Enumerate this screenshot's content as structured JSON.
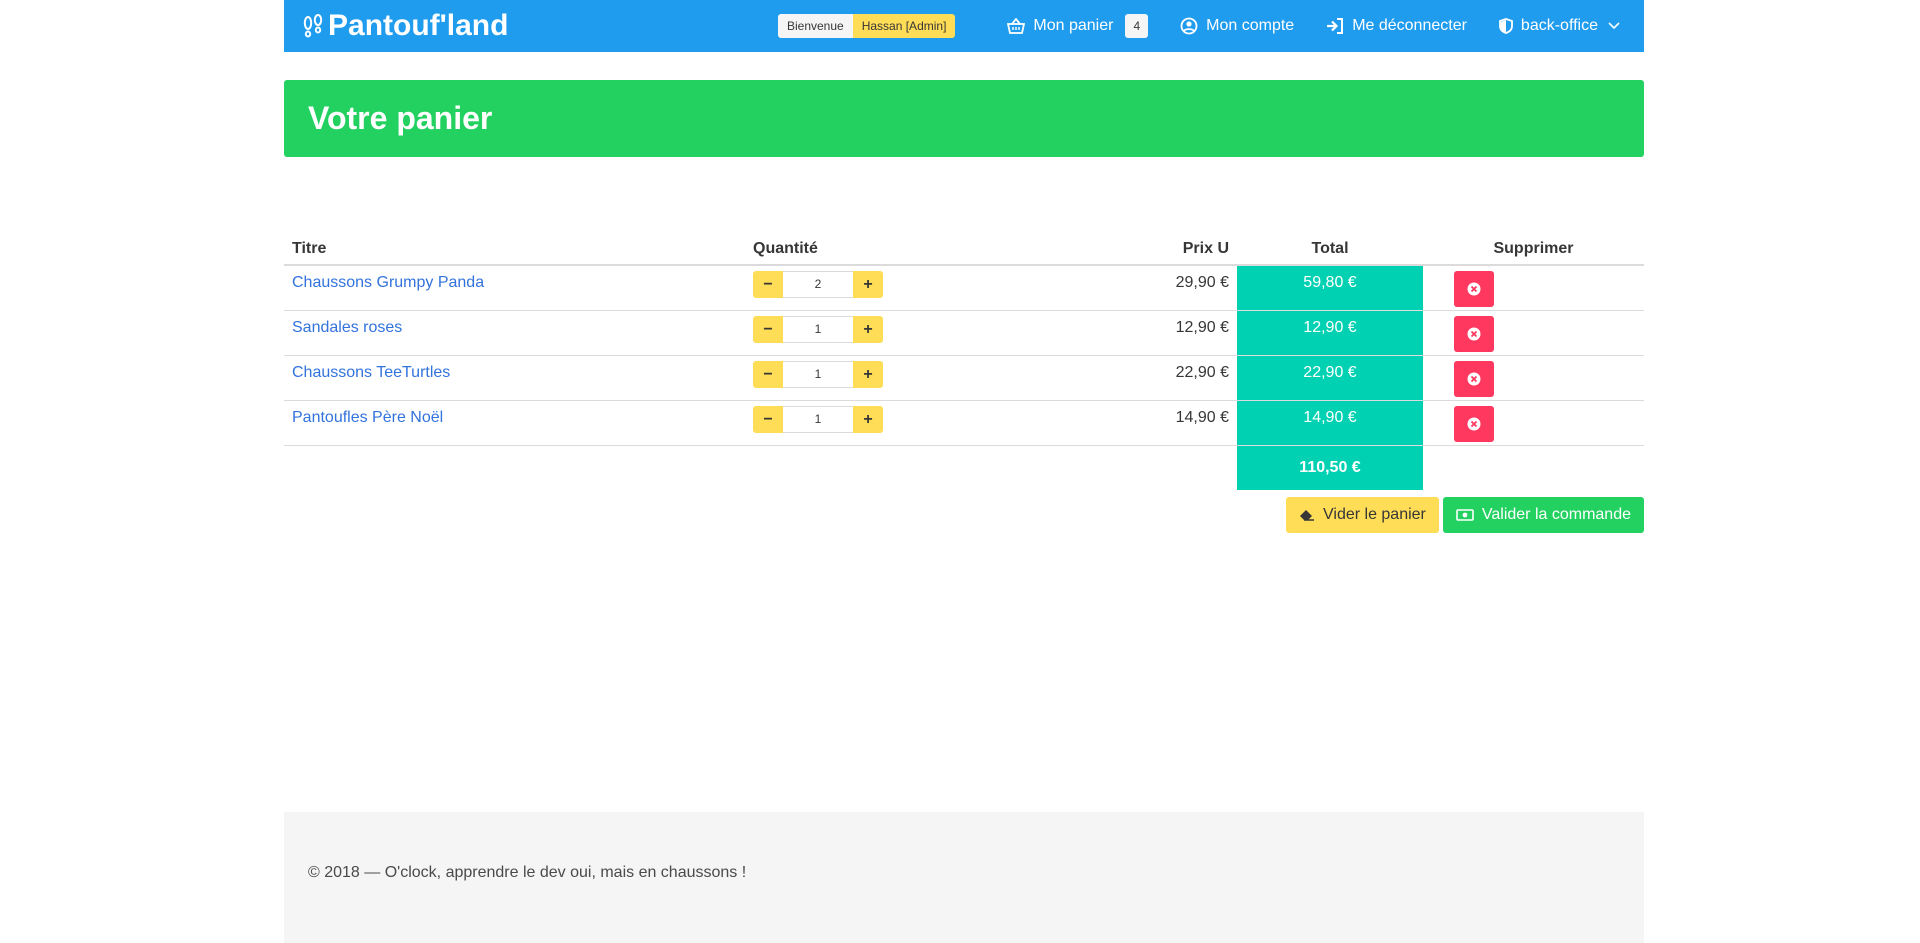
{
  "brand": {
    "name": "Pantouf'land",
    "icon": "footprints-icon"
  },
  "nav": {
    "welcome_label": "Bienvenue",
    "user_label": "Hassan [Admin]",
    "cart_label": "Mon panier",
    "cart_count": "4",
    "account_label": "Mon compte",
    "logout_label": "Me déconnecter",
    "backoffice_label": "back-office"
  },
  "hero": {
    "title": "Votre panier"
  },
  "table": {
    "headers": {
      "title": "Titre",
      "qty": "Quantité",
      "price": "Prix U",
      "total": "Total",
      "delete": "Supprimer"
    },
    "rows": [
      {
        "title": "Chaussons Grumpy Panda",
        "qty": "2",
        "price": "29,90 €",
        "total": "59,80 €"
      },
      {
        "title": "Sandales roses",
        "qty": "1",
        "price": "12,90 €",
        "total": "12,90 €"
      },
      {
        "title": "Chaussons TeeTurtles",
        "qty": "1",
        "price": "22,90 €",
        "total": "22,90 €"
      },
      {
        "title": "Pantoufles Père Noël",
        "qty": "1",
        "price": "14,90 €",
        "total": "14,90 €"
      }
    ],
    "grand_total": "110,50 €"
  },
  "actions": {
    "empty_label": "Vider le panier",
    "validate_label": "Valider la commande"
  },
  "footer": {
    "text": "© 2018 — O'clock, apprendre le dev oui, mais en chaussons !"
  },
  "colors": {
    "navbar": "#209cee",
    "hero": "#23d160",
    "total_cell": "#00d1b2",
    "warning": "#ffdd57",
    "danger": "#ff3860",
    "link": "#3273dc"
  }
}
